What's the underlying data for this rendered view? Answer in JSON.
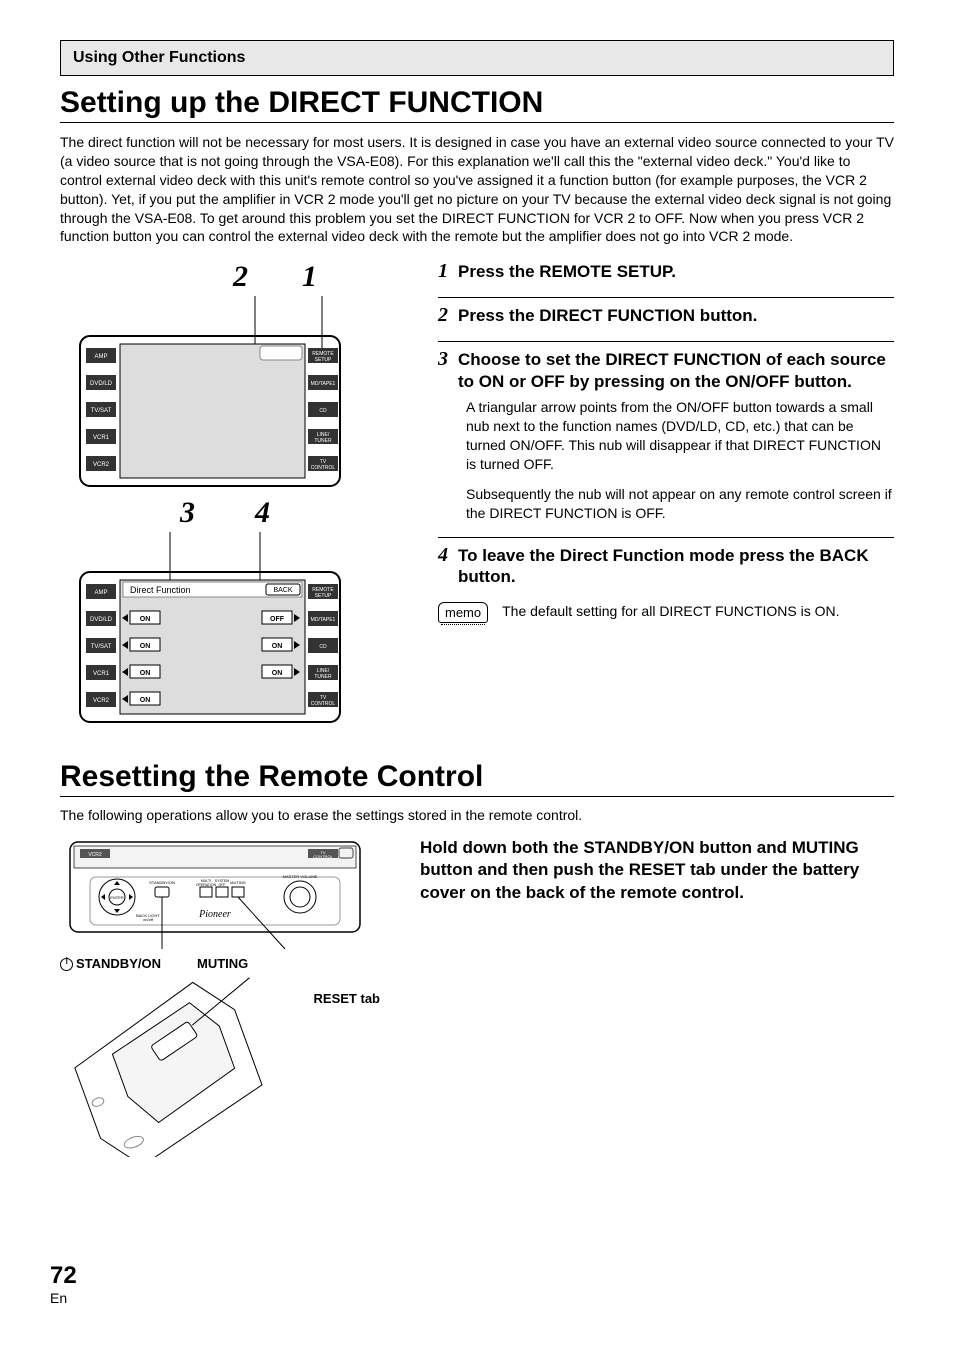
{
  "header": {
    "section": "Using Other Functions"
  },
  "title1": "Setting up the DIRECT FUNCTION",
  "intro": "The direct function will not be necessary for most users. It is designed in case you have an external video source connected to your TV (a video source that is not going through the VSA-E08). For this explanation we'll call this the \"external video deck.\" You'd like to control external video deck with this unit's remote control so you've assigned it a function button (for example purposes, the VCR 2 button). Yet, if you put the amplifier in VCR 2 mode you'll get no picture on your TV because the external video deck signal is not going through the VSA-E08. To get around this problem you set the DIRECT FUNCTION for VCR 2 to OFF. Now when you press VCR 2 function button you can control the external video deck with the remote but the amplifier does not go into VCR 2 mode.",
  "callouts_top": {
    "a": "2",
    "b": "1"
  },
  "callouts_mid": {
    "a": "3",
    "b": "4"
  },
  "remote1": {
    "left": [
      "AMP",
      "DVD/LD",
      "TV/SAT",
      "VCR1",
      "VCR2"
    ],
    "right": [
      "REMOTE SETUP",
      "MD/TAPE1",
      "CD",
      "LINE/ TUNER",
      "TV CONTROL"
    ]
  },
  "remote2": {
    "title": "Direct Function",
    "back": "BACK",
    "left": [
      "AMP",
      "DVD/LD",
      "TV/SAT",
      "VCR1",
      "VCR2"
    ],
    "right": [
      "REMOTE SETUP",
      "MD/TAPE1",
      "CD",
      "LINE/ TUNER",
      "TV CONTROL"
    ],
    "states_left": [
      "",
      "ON",
      "ON",
      "ON",
      "ON"
    ],
    "states_right": [
      "",
      "OFF",
      "ON",
      "ON",
      ""
    ]
  },
  "steps": [
    {
      "n": "1",
      "title": "Press the REMOTE SETUP."
    },
    {
      "n": "2",
      "title": "Press the DIRECT FUNCTION button."
    },
    {
      "n": "3",
      "title": "Choose to set the DIRECT FUNCTION of each source to ON or OFF by pressing on the ON/OFF button.",
      "body": "A triangular arrow points from the ON/OFF button towards a small nub next to the function names (DVD/LD, CD, etc.) that can be turned ON/OFF. This nub will disappear if that DIRECT FUNCTION is turned OFF.",
      "body2": "Subsequently the nub will not appear on any remote control screen if the DIRECT FUNCTION is OFF."
    },
    {
      "n": "4",
      "title": "To leave the Direct Function mode press the BACK button."
    }
  ],
  "memo": {
    "label": "memo",
    "text": "The default setting for all DIRECT FUNCTIONS is ON."
  },
  "title2": "Resetting the Remote Control",
  "reset_intro": "The following operations allow you to erase the settings stored in the remote control.",
  "reset_instruction": "Hold down both the STANDBY/ON button and MUTING button and then push the RESET tab under the battery cover on the back of the remote control.",
  "labels": {
    "standby": "STANDBY/ON",
    "muting": "MUTING",
    "reset_tab": "RESET tab"
  },
  "remote3": {
    "top_left": "VCR2",
    "top_right": "TV CONTROL",
    "brand": "Pioneer",
    "small": [
      "STANDBY/ON",
      "MULTI OPERATION",
      "SYSTEM OFF",
      "MUTING",
      "MASTER VOLUME",
      "ENTER",
      "BACK LIGHT on/off"
    ]
  },
  "page": {
    "num": "72",
    "lang": "En"
  }
}
